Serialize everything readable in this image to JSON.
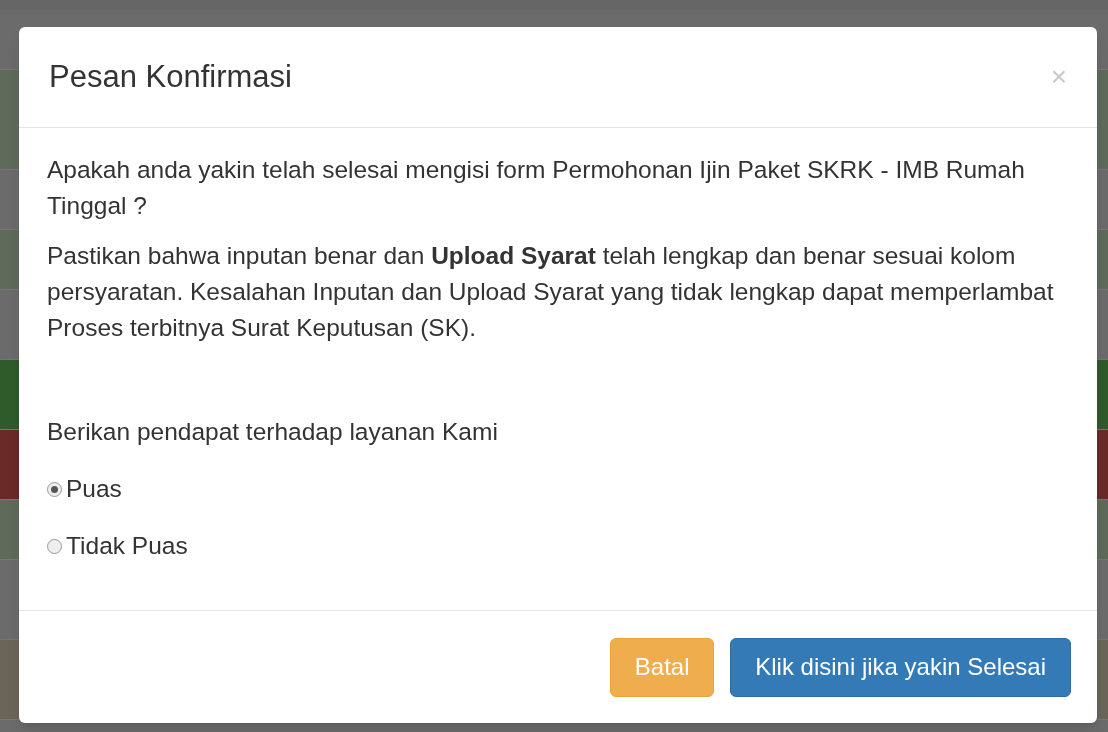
{
  "dialog": {
    "title": "Pesan Konfirmasi",
    "close": "×",
    "paragraphs": [
      "Apakah anda yakin telah selesai mengisi form Permohonan Ijin Paket SKRK - IMB Rumah Tinggal ?",
      "Pastikan bahwa inputan benar dan **Upload Syarat** telah lengkap dan benar sesuai kolom persyaratan. Kesalahan Inputan dan Upload Syarat yang tidak lengkap dapat memperlambat Proses terbitnya Surat Keputusan (SK)."
    ],
    "question": "Berikan pendapat terhadap layanan Kami",
    "options": [
      {
        "label": "Puas",
        "selected": true
      },
      {
        "label": "Tidak Puas",
        "selected": false
      }
    ],
    "buttons": [
      {
        "label": "Batal",
        "kind": "warning"
      },
      {
        "label": "Klik disini jika yakin Selesai",
        "kind": "primary"
      }
    ]
  }
}
